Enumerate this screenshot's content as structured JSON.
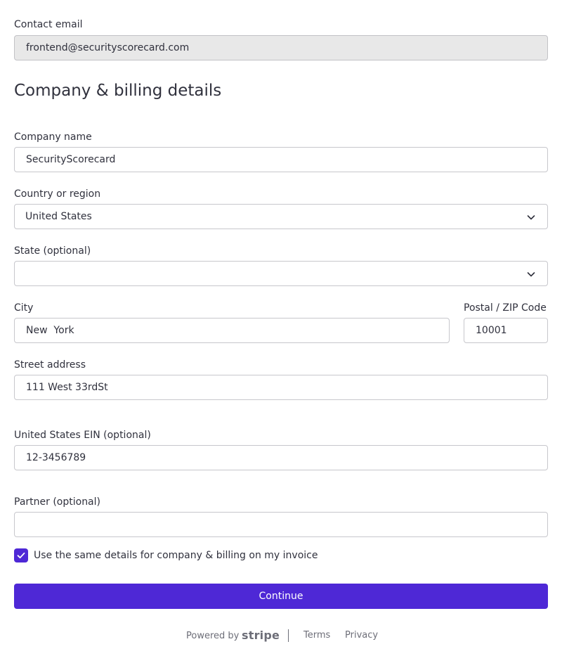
{
  "contact": {
    "label": "Contact email",
    "value": "frontend@securityscorecard.com"
  },
  "section_title": "Company & billing details",
  "company": {
    "label": "Company name",
    "value": "SecurityScorecard"
  },
  "country": {
    "label": "Country or region",
    "value": "United States"
  },
  "state": {
    "label": "State (optional)",
    "value": ""
  },
  "city": {
    "label": "City",
    "value": "New  York"
  },
  "postal": {
    "label": "Postal / ZIP Code",
    "value": "10001"
  },
  "street": {
    "label": "Street address",
    "value": "111 West 33rdSt"
  },
  "ein": {
    "label": "United States EIN (optional)",
    "value": "12-3456789"
  },
  "partner": {
    "label": "Partner (optional)",
    "value": ""
  },
  "same_details": {
    "label": "Use the same details for company & billing on my invoice",
    "checked": true
  },
  "continue_label": "Continue",
  "footer": {
    "powered_by": "Powered by",
    "brand": "stripe",
    "terms": "Terms",
    "privacy": "Privacy"
  },
  "colors": {
    "accent": "#4e28d6",
    "disabled_bg": "#e8e8e8",
    "text": "#30313d",
    "muted": "#6d6e78"
  },
  "icons": {
    "select": "chevron-down-icon",
    "checkbox": "checkmark-icon"
  }
}
